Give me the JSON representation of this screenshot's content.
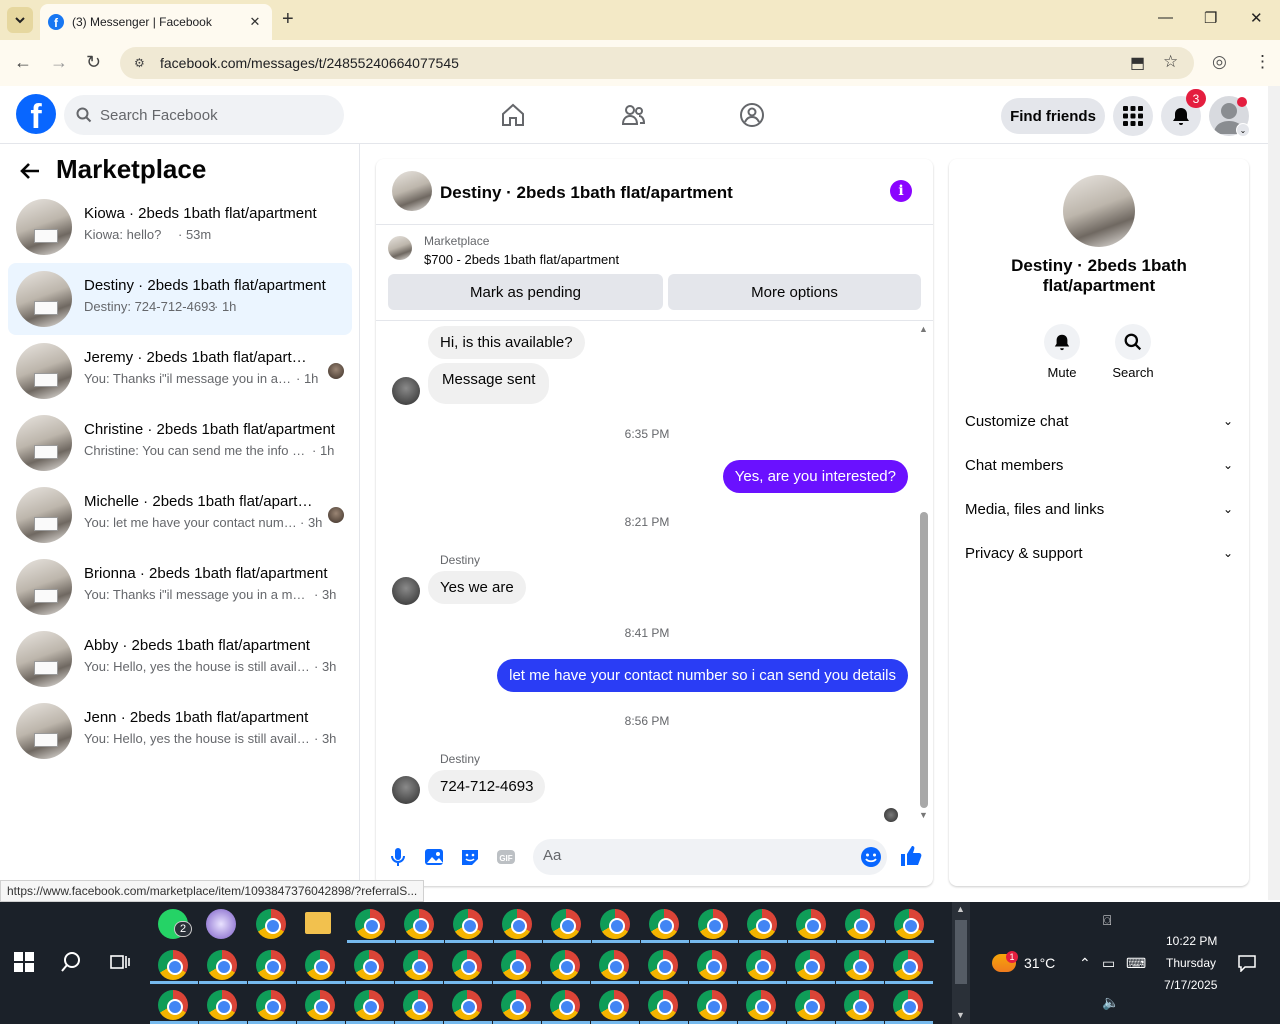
{
  "browser": {
    "tab_title": "(3) Messenger | Facebook",
    "url": "facebook.com/messages/t/24855240664077545",
    "status_url": "https://www.facebook.com/marketplace/item/1093847376042898/?referralS..."
  },
  "header": {
    "search_placeholder": "Search Facebook",
    "find_friends": "Find friends",
    "notification_count": "3"
  },
  "left": {
    "title": "Marketplace",
    "conversations": [
      {
        "name": "Kiowa · 2beds 1bath flat/apartment",
        "preview": "Kiowa: hello?",
        "time": "· 53m"
      },
      {
        "name": "Destiny · 2beds 1bath flat/apartment",
        "preview": "Destiny: 724-712-4693",
        "time": "· 1h"
      },
      {
        "name": "Jeremy · 2beds 1bath flat/apartment",
        "preview": "You: Thanks i\"il message you in a …",
        "time": "· 1h"
      },
      {
        "name": "Christine · 2beds 1bath flat/apartment",
        "preview": "Christine: You can send me the info h…",
        "time": "· 1h"
      },
      {
        "name": "Michelle · 2beds 1bath flat/apartment",
        "preview": "You: let me have your contact num…",
        "time": "· 3h"
      },
      {
        "name": "Brionna · 2beds 1bath flat/apartment",
        "preview": "You: Thanks i\"il message you in a mo…",
        "time": "· 3h"
      },
      {
        "name": "Abby · 2beds 1bath flat/apartment",
        "preview": "You: Hello, yes the house is still availa…",
        "time": "· 3h"
      },
      {
        "name": "Jenn · 2beds 1bath flat/apartment",
        "preview": "You: Hello, yes the house is still availa…",
        "time": "· 3h"
      }
    ]
  },
  "chat": {
    "title": "Destiny · 2beds 1bath flat/apartment",
    "marketplace_label": "Marketplace",
    "item": "$700 - 2beds 1bath flat/apartment",
    "mark_pending": "Mark as pending",
    "more_options": "More options",
    "messages": {
      "m1": "Hi, is this available?",
      "m2": "Message sent",
      "t1": "6:35 PM",
      "m3": "Yes, are you interested?",
      "t2": "8:21 PM",
      "sender1": "Destiny",
      "m4": "Yes we are",
      "t3": "8:41 PM",
      "m5": "let me have your contact number so i can send you details",
      "t4": "8:56 PM",
      "sender2": "Destiny",
      "m6": "724-712-4693"
    },
    "composer_placeholder": "Aa"
  },
  "right": {
    "name": "Destiny · 2beds 1bath flat/apartment",
    "mute": "Mute",
    "search": "Search",
    "sections": [
      "Customize chat",
      "Chat members",
      "Media, files and links",
      "Privacy & support"
    ]
  },
  "taskbar": {
    "temperature": "31°C",
    "time": "10:22 PM",
    "day": "Thursday",
    "date": "7/17/2025",
    "whatsapp_badge": "2",
    "weather_badge": "1"
  },
  "colors": {
    "accent": "#6a11ff",
    "fb_blue": "#0866ff",
    "blue_bubble": "#2a3df5"
  }
}
